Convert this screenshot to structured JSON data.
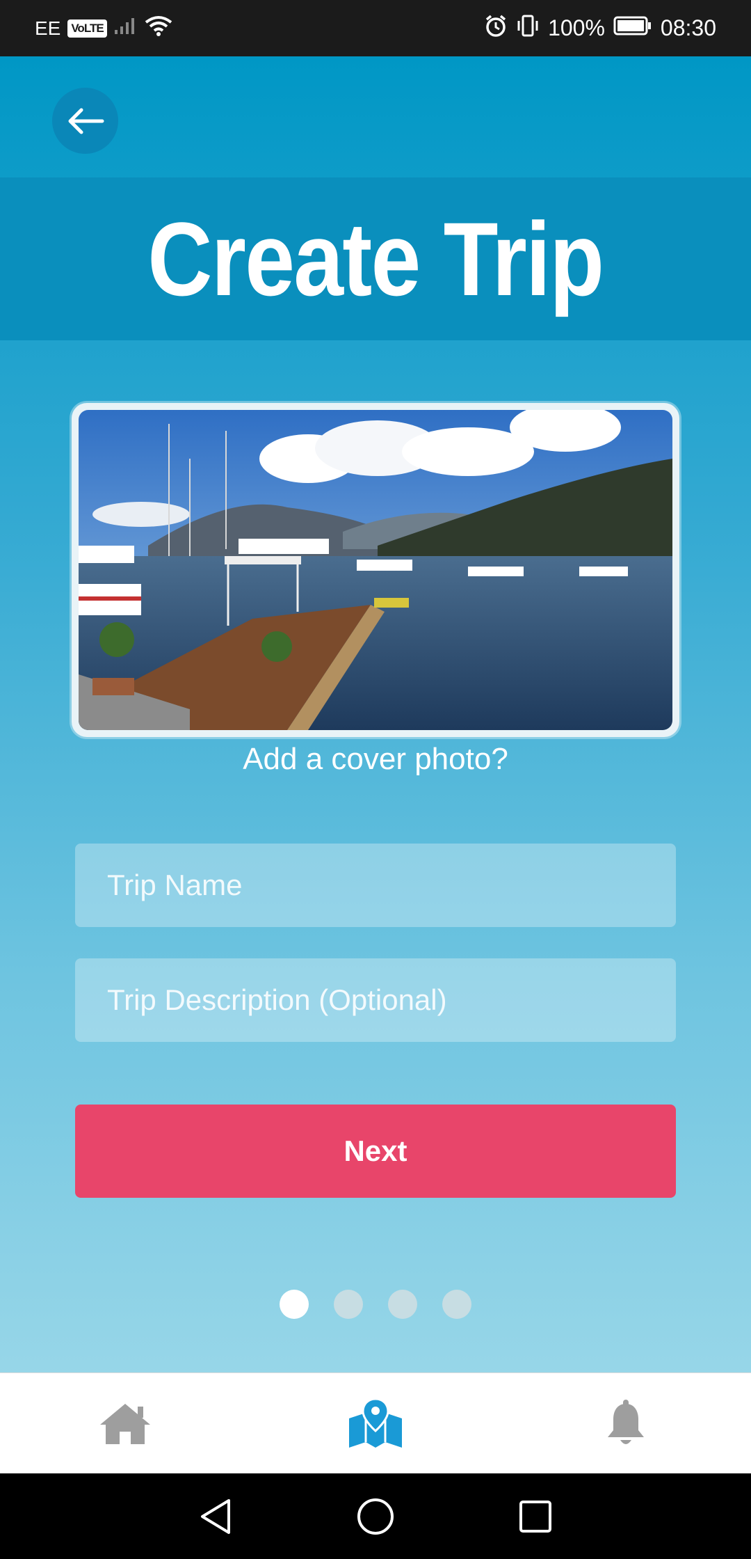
{
  "status_bar": {
    "carrier": "EE",
    "volte": "VoLTE",
    "battery": "100%",
    "time": "08:30"
  },
  "header": {
    "back_icon": "arrow-left-icon",
    "title": "Create Trip"
  },
  "cover": {
    "caption": "Add a cover photo?"
  },
  "form": {
    "trip_name_placeholder": "Trip Name",
    "trip_description_placeholder": "Trip Description (Optional)",
    "next_label": "Next"
  },
  "pager": {
    "total_pages": 4,
    "active_page": 1
  },
  "bottom_nav": {
    "items": [
      {
        "icon": "home-icon",
        "active": false
      },
      {
        "icon": "map-icon",
        "active": true
      },
      {
        "icon": "bell-icon",
        "active": false
      }
    ]
  },
  "colors": {
    "primary": "#0097c5",
    "accent": "#e8456a",
    "nav_active": "#1a9ad6",
    "nav_inactive": "#9e9e9e"
  }
}
